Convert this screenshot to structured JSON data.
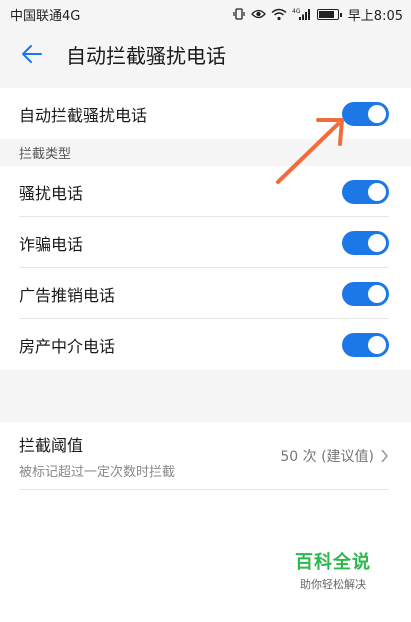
{
  "status_bar": {
    "carrier": "中国联通4G",
    "network_tag": "4G",
    "time": "早上8:05",
    "battery_level": 0.85
  },
  "header": {
    "title": "自动拦截骚扰电话",
    "back_icon": "back-arrow-icon"
  },
  "main_toggle": {
    "label": "自动拦截骚扰电话",
    "on": true
  },
  "section": {
    "title": "拦截类型"
  },
  "types": [
    {
      "label": "骚扰电话",
      "on": true
    },
    {
      "label": "诈骗电话",
      "on": true
    },
    {
      "label": "广告推销电话",
      "on": true
    },
    {
      "label": "房产中介电话",
      "on": true
    }
  ],
  "threshold": {
    "title": "拦截阈值",
    "subtitle": "被标记超过一定次数时拦截",
    "value": "50 次 (建议值)"
  },
  "watermark": {
    "logo": "百科全说",
    "tagline": "助你轻松解决"
  },
  "colors": {
    "accent": "#1c78e6",
    "annotation_arrow": "#f26b3a",
    "watermark_green": "#2db84d"
  }
}
